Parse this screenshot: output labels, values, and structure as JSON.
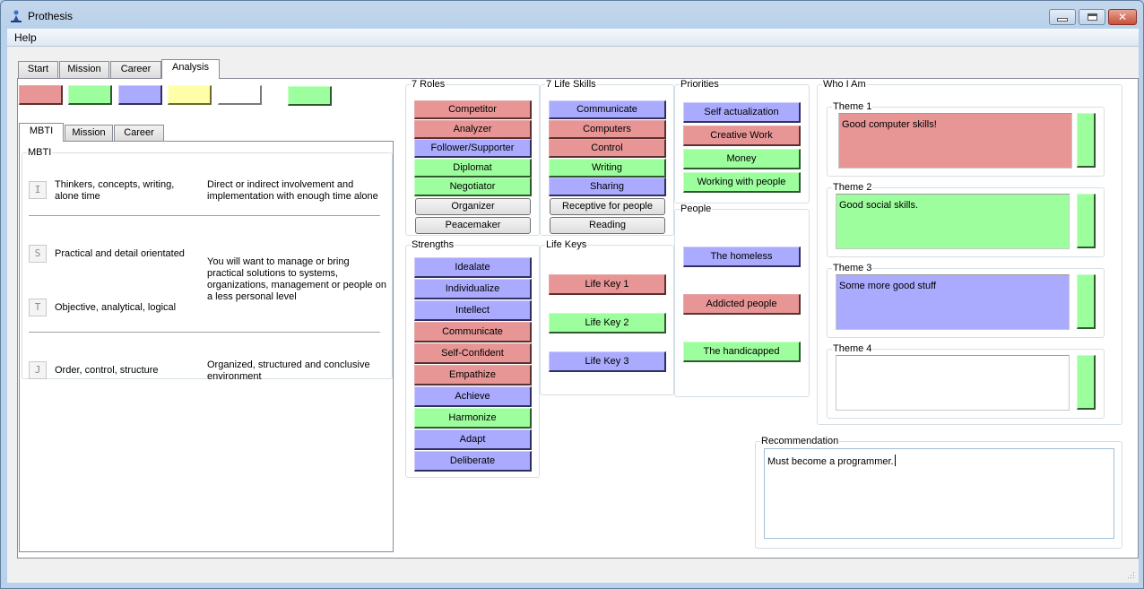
{
  "window": {
    "title": "Prothesis",
    "controls": {
      "minimize": "minimize",
      "maximize": "maximize",
      "close": "close"
    }
  },
  "menubar": {
    "items": [
      {
        "label": "Help"
      }
    ]
  },
  "main_tabs": [
    {
      "label": "Start",
      "active": false
    },
    {
      "label": "Mission",
      "active": false
    },
    {
      "label": "Career",
      "active": false
    },
    {
      "label": "Analysis",
      "active": true
    }
  ],
  "colors": {
    "red": "#e79595",
    "green": "#9dfe9d",
    "blue": "#aaaafe",
    "yellow": "#fefea8",
    "white": "#ffffff"
  },
  "swatches": [
    "red",
    "green",
    "blue",
    "yellow",
    "white",
    "green"
  ],
  "sub_tabs": [
    {
      "label": "MBTI",
      "active": true
    },
    {
      "label": "Mission",
      "active": false
    },
    {
      "label": "Career",
      "active": false
    }
  ],
  "mbti": {
    "group_label": "MBTI",
    "rows": [
      {
        "letter": "I",
        "text": "Thinkers, concepts, writing, alone time",
        "description": "Direct or indirect involvement and implementation with enough time alone"
      },
      {
        "letter": "S",
        "text": "Practical and detail orientated"
      },
      {
        "letter": "T",
        "text": "Objective, analytical, logical"
      },
      {
        "letter": "J",
        "text": "Order, control, structure",
        "description": "Organized, structured and conclusive environment"
      }
    ],
    "st_description": "You will want to manage or bring practical solutions to systems, organizations, management or people on a less personal level"
  },
  "roles": {
    "label": "7 Roles",
    "items": [
      {
        "label": "Competitor",
        "color": "red"
      },
      {
        "label": "Analyzer",
        "color": "red"
      },
      {
        "label": "Follower/Supporter",
        "color": "blue"
      },
      {
        "label": "Diplomat",
        "color": "green"
      },
      {
        "label": "Negotiator",
        "color": "green"
      },
      {
        "label": "Organizer",
        "color": "none"
      },
      {
        "label": "Peacemaker",
        "color": "none"
      }
    ]
  },
  "life_skills": {
    "label": "7 Life Skills",
    "items": [
      {
        "label": "Communicate",
        "color": "blue"
      },
      {
        "label": "Computers",
        "color": "red"
      },
      {
        "label": "Control",
        "color": "red"
      },
      {
        "label": "Writing",
        "color": "green"
      },
      {
        "label": "Sharing",
        "color": "blue"
      },
      {
        "label": "Receptive for people",
        "color": "none"
      },
      {
        "label": "Reading",
        "color": "none"
      }
    ]
  },
  "strengths": {
    "label": "Strengths",
    "items": [
      {
        "label": "Idealate",
        "color": "blue"
      },
      {
        "label": "Individualize",
        "color": "blue"
      },
      {
        "label": "Intellect",
        "color": "blue"
      },
      {
        "label": "Communicate",
        "color": "red"
      },
      {
        "label": "Self-Confident",
        "color": "red"
      },
      {
        "label": "Empathize",
        "color": "red"
      },
      {
        "label": "Achieve",
        "color": "blue"
      },
      {
        "label": "Harmonize",
        "color": "green"
      },
      {
        "label": "Adapt",
        "color": "blue"
      },
      {
        "label": "Deliberate",
        "color": "blue"
      }
    ]
  },
  "life_keys": {
    "label": "Life Keys",
    "items": [
      {
        "label": "Life Key 1",
        "color": "red"
      },
      {
        "label": "Life Key 2",
        "color": "green"
      },
      {
        "label": "Life Key 3",
        "color": "blue"
      }
    ]
  },
  "priorities": {
    "label": "Priorities",
    "items": [
      {
        "label": "Self actualization",
        "color": "blue"
      },
      {
        "label": "Creative Work",
        "color": "red"
      },
      {
        "label": "Money",
        "color": "green"
      },
      {
        "label": "Working with people",
        "color": "green"
      }
    ]
  },
  "people": {
    "label": "People",
    "items": [
      {
        "label": "The homeless",
        "color": "blue"
      },
      {
        "label": "Addicted people",
        "color": "red"
      },
      {
        "label": "The handicapped",
        "color": "green"
      }
    ]
  },
  "who_i_am": {
    "label": "Who I Am",
    "themes": [
      {
        "label": "Theme 1",
        "text": "Good computer skills!",
        "color": "red",
        "button_color": "green"
      },
      {
        "label": "Theme 2",
        "text": "Good social skills.",
        "color": "green",
        "button_color": "green"
      },
      {
        "label": "Theme 3",
        "text": "Some more good stuff",
        "color": "blue",
        "button_color": "green"
      },
      {
        "label": "Theme 4",
        "text": "",
        "color": "white",
        "button_color": "green"
      }
    ]
  },
  "recommendation": {
    "label": "Recommendation",
    "text": "Must become a programmer."
  }
}
